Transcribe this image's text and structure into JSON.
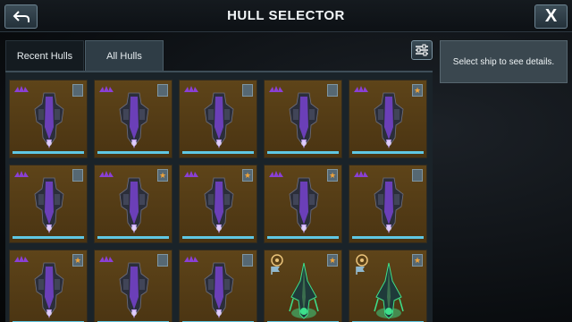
{
  "header": {
    "title": "HULL SELECTOR",
    "close_label": "X"
  },
  "tabs": [
    {
      "label": "Recent Hulls",
      "active": false
    },
    {
      "label": "All Hulls",
      "active": true
    }
  ],
  "details": {
    "prompt": "Select ship to see details."
  },
  "colors": {
    "card_bg": "#5e4419",
    "bar": "#5fc7e3",
    "faction_purple": "#8a3fd6",
    "star": "#f0a43a",
    "ship_purple": "#6b3fb8",
    "ship_green": "#3de08b"
  },
  "cards": [
    {
      "faction": "purple-faction-icon",
      "badge": "plain",
      "ship": "purple-ship"
    },
    {
      "faction": "purple-faction-icon",
      "badge": "plain",
      "ship": "purple-ship"
    },
    {
      "faction": "purple-faction-icon",
      "badge": "plain",
      "ship": "purple-ship"
    },
    {
      "faction": "purple-faction-icon",
      "badge": "plain",
      "ship": "purple-ship"
    },
    {
      "faction": "purple-faction-icon",
      "badge": "star",
      "ship": "purple-ship"
    },
    {
      "faction": "purple-faction-icon",
      "badge": "plain",
      "ship": "purple-ship"
    },
    {
      "faction": "purple-faction-icon",
      "badge": "star",
      "ship": "purple-ship"
    },
    {
      "faction": "purple-faction-icon",
      "badge": "star",
      "ship": "purple-ship"
    },
    {
      "faction": "purple-faction-icon",
      "badge": "star",
      "ship": "purple-ship"
    },
    {
      "faction": "purple-faction-icon",
      "badge": "plain",
      "ship": "purple-ship"
    },
    {
      "faction": "purple-faction-icon",
      "badge": "star",
      "ship": "purple-ship"
    },
    {
      "faction": "purple-faction-icon",
      "badge": "plain",
      "ship": "purple-ship"
    },
    {
      "faction": "purple-faction-icon",
      "badge": "plain",
      "ship": "purple-ship"
    },
    {
      "faction": "flag-faction-icon",
      "badge": "star",
      "ship": "green-ship"
    },
    {
      "faction": "flag-faction-icon",
      "badge": "star",
      "ship": "green-ship"
    }
  ]
}
